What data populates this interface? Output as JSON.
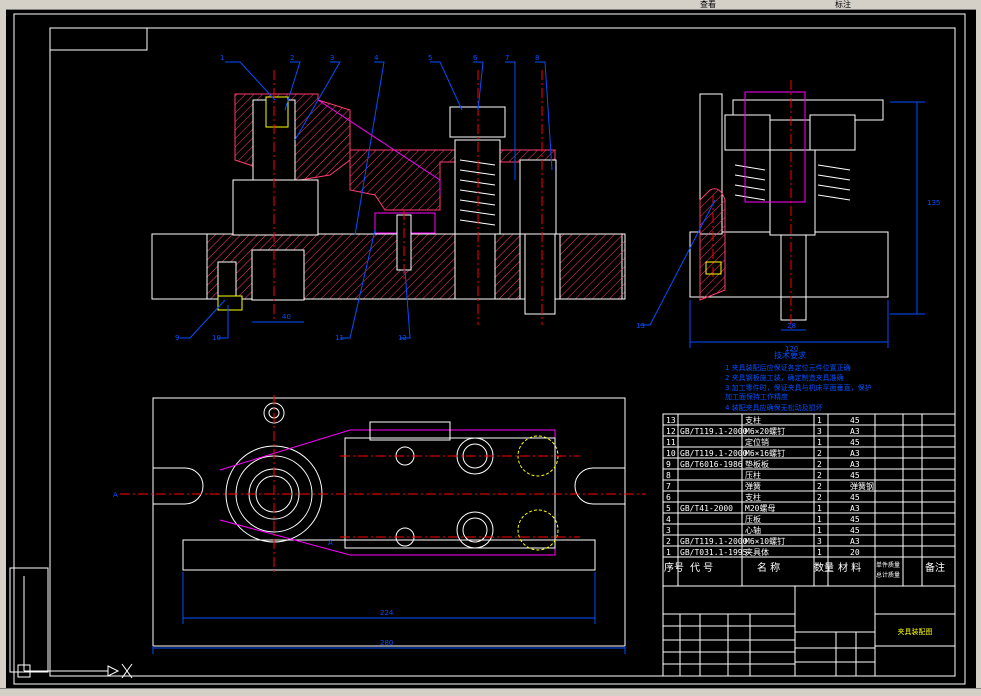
{
  "window": {
    "menu_items": [
      "查看",
      "标注"
    ]
  },
  "tech_req": {
    "title": "技术要求",
    "lines": [
      "1  夹具装配后应保证各定位元件位置正确",
      "2  夹具钢板施工装，确定制造夹具准确",
      "3  加工零件时，保证夹具与机床平面垂直，保护",
      "   加工面保持工作精度",
      "4  装配夹具应确保无松动及损坏"
    ]
  },
  "bom": {
    "headers": [
      "序号",
      "代 号",
      "名 称",
      "数量",
      "材 料",
      "单件质量",
      "总计质量",
      "备注"
    ],
    "rows": [
      {
        "no": "13",
        "code": "",
        "name": "支柱",
        "qty": "1",
        "mat": "45"
      },
      {
        "no": "12",
        "code": "GB/T119.1-2000",
        "name": "M6×20螺钉",
        "qty": "3",
        "mat": "A3"
      },
      {
        "no": "11",
        "code": "",
        "name": "定位销",
        "qty": "1",
        "mat": "45"
      },
      {
        "no": "10",
        "code": "GB/T119.1-2000",
        "name": "M6×16螺钉",
        "qty": "2",
        "mat": "A3"
      },
      {
        "no": "9",
        "code": "GB/T6016-1986",
        "name": "垫板板",
        "qty": "2",
        "mat": "A3"
      },
      {
        "no": "8",
        "code": "",
        "name": "压柱",
        "qty": "2",
        "mat": "45"
      },
      {
        "no": "7",
        "code": "",
        "name": "弹簧",
        "qty": "2",
        "mat": "弹簧钢"
      },
      {
        "no": "6",
        "code": "",
        "name": "支柱",
        "qty": "2",
        "mat": "45"
      },
      {
        "no": "5",
        "code": "GB/T41-2000",
        "name": "M20螺母",
        "qty": "1",
        "mat": "A3"
      },
      {
        "no": "4",
        "code": "",
        "name": "压板",
        "qty": "1",
        "mat": "45"
      },
      {
        "no": "3",
        "code": "",
        "name": "心轴",
        "qty": "1",
        "mat": "45"
      },
      {
        "no": "2",
        "code": "GB/T119.1-2000",
        "name": "M6×10螺钉",
        "qty": "3",
        "mat": "A3"
      },
      {
        "no": "1",
        "code": "GB/T031.1-1995",
        "name": "夹具体",
        "qty": "1",
        "mat": "20"
      }
    ]
  },
  "title_block": {
    "drawing_name": "夹具装配图"
  },
  "dims": {
    "d40": "40",
    "d120": "120",
    "d28": "28",
    "d135": "135",
    "d224": "224",
    "d280": "280"
  },
  "callouts": [
    "1",
    "2",
    "3",
    "4",
    "5",
    "6",
    "7",
    "8",
    "9",
    "10",
    "11",
    "12",
    "13"
  ],
  "section_marks": {
    "a": "A",
    "b": "A"
  },
  "colors": {
    "outline": "#ffffff",
    "section": "#ff3c6e",
    "magenta": "#ff00ff",
    "center": "#ff0000",
    "dim": "#0050ff",
    "yellow": "#ffff00",
    "cyan": "#00ffff"
  }
}
